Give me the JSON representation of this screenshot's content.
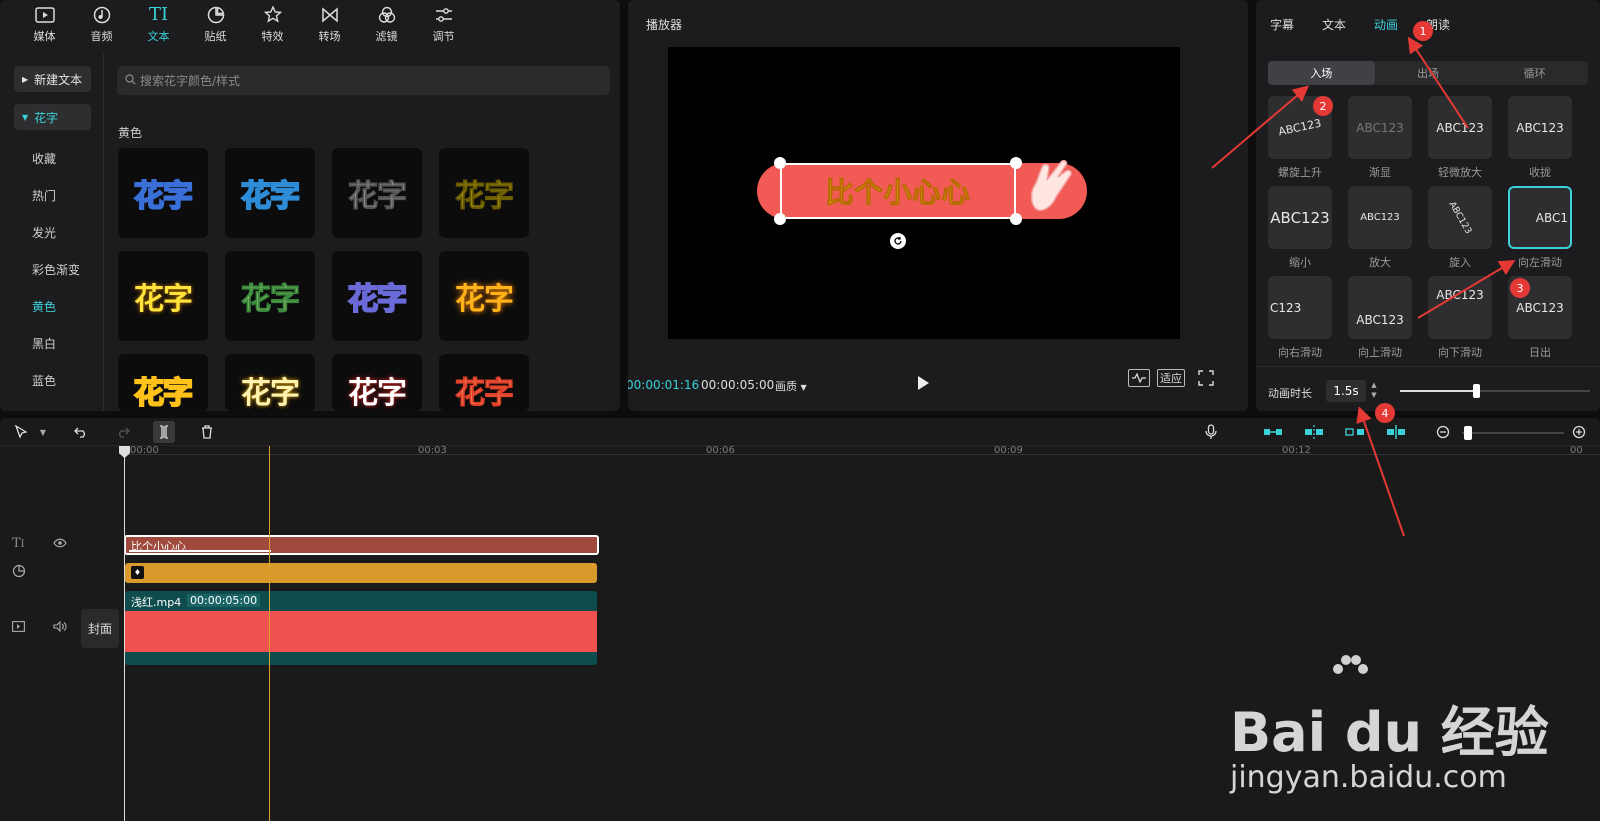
{
  "toolbar": {
    "items": [
      {
        "label": "媒体",
        "icon": "media-icon"
      },
      {
        "label": "音频",
        "icon": "audio-icon"
      },
      {
        "label": "文本",
        "icon": "text-icon"
      },
      {
        "label": "贴纸",
        "icon": "sticker-icon"
      },
      {
        "label": "特效",
        "icon": "effects-icon"
      },
      {
        "label": "转场",
        "icon": "transition-icon"
      },
      {
        "label": "滤镜",
        "icon": "filter-icon"
      },
      {
        "label": "调节",
        "icon": "adjust-icon"
      }
    ],
    "text_glyph": "TI",
    "active_index": 2
  },
  "sidebar": {
    "new_text": "新建文本",
    "section": "花字",
    "items": [
      "收藏",
      "热门",
      "发光",
      "彩色渐变",
      "黄色",
      "黑白",
      "蓝色"
    ],
    "active": "黄色"
  },
  "search": {
    "placeholder": "搜索花字颜色/样式"
  },
  "grid": {
    "title": "黄色",
    "tile_text": "花字"
  },
  "player": {
    "title": "播放器",
    "caption": "比个小心心",
    "current_time": "00:00:01:16",
    "total_time": "00:00:05:00",
    "quality": "画质",
    "fit": "适应"
  },
  "right": {
    "tabs": [
      "字幕",
      "文本",
      "动画",
      "朗读"
    ],
    "active_tab": "动画",
    "segments": [
      "入场",
      "出场",
      "循环"
    ],
    "active_segment": "入场",
    "cards": [
      {
        "label": "螺旋上升",
        "preview": "ABC123"
      },
      {
        "label": "渐显",
        "preview": "ABC123"
      },
      {
        "label": "轻微放大",
        "preview": "ABC123"
      },
      {
        "label": "收拢",
        "preview": "ABC123"
      },
      {
        "label": "缩小",
        "preview": "ABC123"
      },
      {
        "label": "放大",
        "preview": "ABC123"
      },
      {
        "label": "旋入",
        "preview": "ABC123"
      },
      {
        "label": "向左滑动",
        "preview": "ABC1"
      },
      {
        "label": "向右滑动",
        "preview": "C123"
      },
      {
        "label": "向上滑动",
        "preview": "ABC123"
      },
      {
        "label": "向下滑动",
        "preview": "ABC123"
      },
      {
        "label": "日出",
        "preview": "ABC123"
      }
    ],
    "duration_label": "动画时长",
    "duration_value": "1.5s",
    "duration_fraction": 0.4
  },
  "badges": [
    "1",
    "2",
    "3",
    "4"
  ],
  "timeline": {
    "ruler": [
      "00:00",
      "00:03",
      "00:06",
      "00:09",
      "00:12",
      "00"
    ],
    "text_clip": "比个小心心",
    "video_clip_name": "浅红.mp4",
    "video_clip_duration": "00:00:05:00",
    "cover": "封面",
    "zoom_fraction": 0.02
  },
  "watermark": {
    "brand": "Bai du 经验",
    "url": "jingyan.baidu.com"
  },
  "colors": {
    "accent": "#3ad1d8",
    "text_clip": "#a04a3e",
    "effect_clip": "#d99a2b",
    "video_clip": "#0e4c4e",
    "video_fill": "#f0524f",
    "badge": "#e53935"
  }
}
